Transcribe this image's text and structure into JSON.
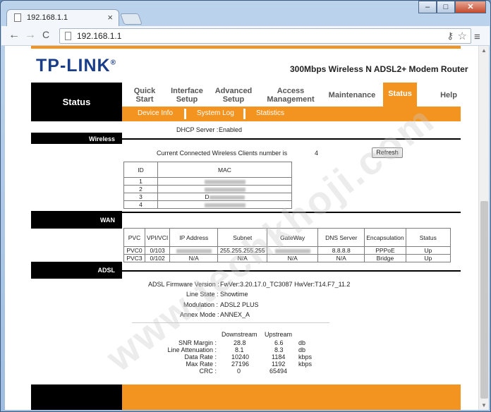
{
  "browser": {
    "tab_title": "192.168.1.1",
    "tab_close": "×",
    "url": "192.168.1.1",
    "back": "←",
    "forward": "→",
    "reload": "C",
    "menu": "≡",
    "win_min": "–",
    "win_max": "□",
    "win_close": "✕"
  },
  "header": {
    "logo": "TP-LINK",
    "logo_mark": "®",
    "model": "300Mbps Wireless N ADSL2+ Modem Router"
  },
  "nav": {
    "current": "Status",
    "items": [
      {
        "label1": "Quick",
        "label2": "Start"
      },
      {
        "label1": "Interface",
        "label2": "Setup"
      },
      {
        "label1": "Advanced",
        "label2": "Setup"
      },
      {
        "label1": "Access",
        "label2": "Management"
      },
      {
        "label1": "Maintenance",
        "label2": ""
      },
      {
        "label1": "Status",
        "label2": ""
      },
      {
        "label1": "Help",
        "label2": ""
      }
    ],
    "subitems": [
      "Device Info",
      "System Log",
      "Statistics"
    ]
  },
  "lan": {
    "dhcp_label": "DHCP Server :",
    "dhcp_value": "Enabled"
  },
  "wireless": {
    "section": "Wireless",
    "clients_label": "Current Connected Wireless Clients number is",
    "clients_count": "4",
    "refresh": "Refresh",
    "headers": [
      "ID",
      "MAC"
    ],
    "ids": [
      "1",
      "2",
      "3",
      "4"
    ],
    "mac_partial_3": "D"
  },
  "wan": {
    "section": "WAN",
    "headers": [
      "PVC",
      "VPI/VCI",
      "IP Address",
      "Subnet",
      "GateWay",
      "DNS Server",
      "Encapsulation",
      "Status"
    ],
    "rows": [
      [
        "PVC0",
        "0/103",
        "",
        "255.255.255.255",
        "",
        "8.8.8.8",
        "PPPoE",
        "Up"
      ],
      [
        "PVC3",
        "0/102",
        "N/A",
        "N/A",
        "N/A",
        "N/A",
        "Bridge",
        "Up"
      ]
    ]
  },
  "adsl": {
    "section": "ADSL",
    "firmware_label": "ADSL Firmware Version :",
    "firmware_value": "FwVer:3.20.17.0_TC3087 HwVer:T14.F7_11.2",
    "line_state_label": "Line State :",
    "line_state_value": "Showtime",
    "modulation_label": "Modulation :",
    "modulation_value": "ADSL2 PLUS",
    "annex_label": "Annex Mode :",
    "annex_value": "ANNEX_A",
    "col_down": "Downstream",
    "col_up": "Upstream",
    "stats": [
      {
        "label": "SNR Margin :",
        "down": "28.8",
        "up": "6.6",
        "unit": "db"
      },
      {
        "label": "Line Attenuation :",
        "down": "8.1",
        "up": "8.3",
        "unit": "db"
      },
      {
        "label": "Data Rate :",
        "down": "10240",
        "up": "1184",
        "unit": "kbps"
      },
      {
        "label": "Max Rate :",
        "down": "27196",
        "up": "1192",
        "unit": "kbps"
      },
      {
        "label": "CRC :",
        "down": "0",
        "up": "65494",
        "unit": ""
      }
    ]
  },
  "watermark": "www.techkhoji.com"
}
